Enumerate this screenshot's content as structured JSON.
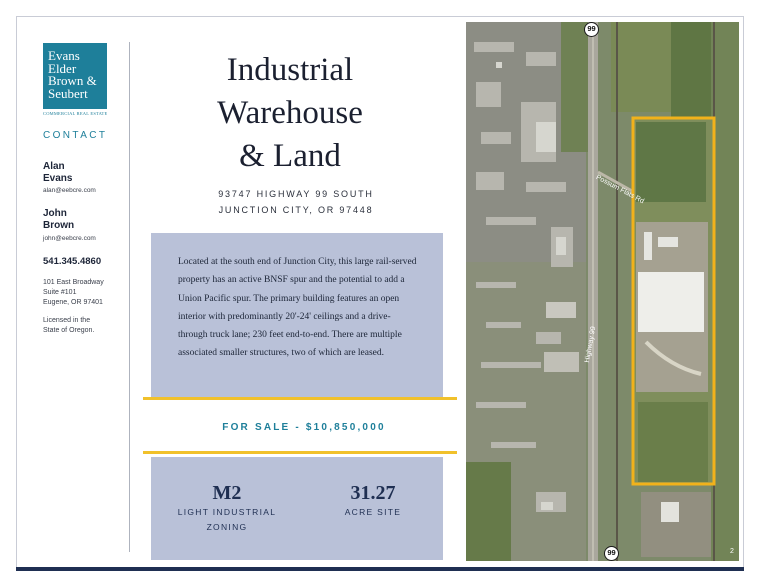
{
  "brand": {
    "logo_line1": "Evans",
    "logo_line2": "Elder",
    "logo_line3": "Brown &",
    "logo_line4": "Seubert",
    "tagline": "COMMERCIAL REAL ESTATE",
    "color": "#1e7f9a"
  },
  "contact": {
    "heading": "CONTACT",
    "agents": [
      {
        "first": "Alan",
        "last": "Evans",
        "email": "alan@eebcre.com"
      },
      {
        "first": "John",
        "last": "Brown",
        "email": "john@eebcre.com"
      }
    ],
    "phone": "541.345.4860",
    "address_line1": "101 East Broadway",
    "address_line2": "Suite #101",
    "address_line3": "Eugene, OR 97401",
    "license_line1": "Licensed in the",
    "license_line2": "State of Oregon."
  },
  "property": {
    "title_line1": "Industrial",
    "title_line2": "Warehouse",
    "title_line3": "& Land",
    "street": "93747 HIGHWAY 99 SOUTH",
    "city": "JUNCTION CITY, OR 97448",
    "description": "Located at the south end of Junction City, this large rail-served property has an active BNSF spur and the potential to add a Union Pacific spur. The primary building features an open interior with predominantly 20'-24' ceilings and a drive-through truck lane; 230 feet end-to-end. There are multiple associated smaller structures, two of which are leased.",
    "sale": "FOR SALE - $10,850,000",
    "zoning_value": "M2",
    "zoning_label1": "LIGHT INDUSTRIAL",
    "zoning_label2": "ZONING",
    "acre_value": "31.27",
    "acre_label": "ACRE SITE"
  },
  "map": {
    "shield_top": "99",
    "shield_bottom": "99",
    "road_label1": "Possum Flats Rd",
    "road_label2": "Highway 99",
    "page_number": "2",
    "outline_color": "#f1b21b"
  },
  "colors": {
    "navy": "#1f2f52",
    "panel": "#b9c1d8",
    "gold": "#f1c12b"
  }
}
